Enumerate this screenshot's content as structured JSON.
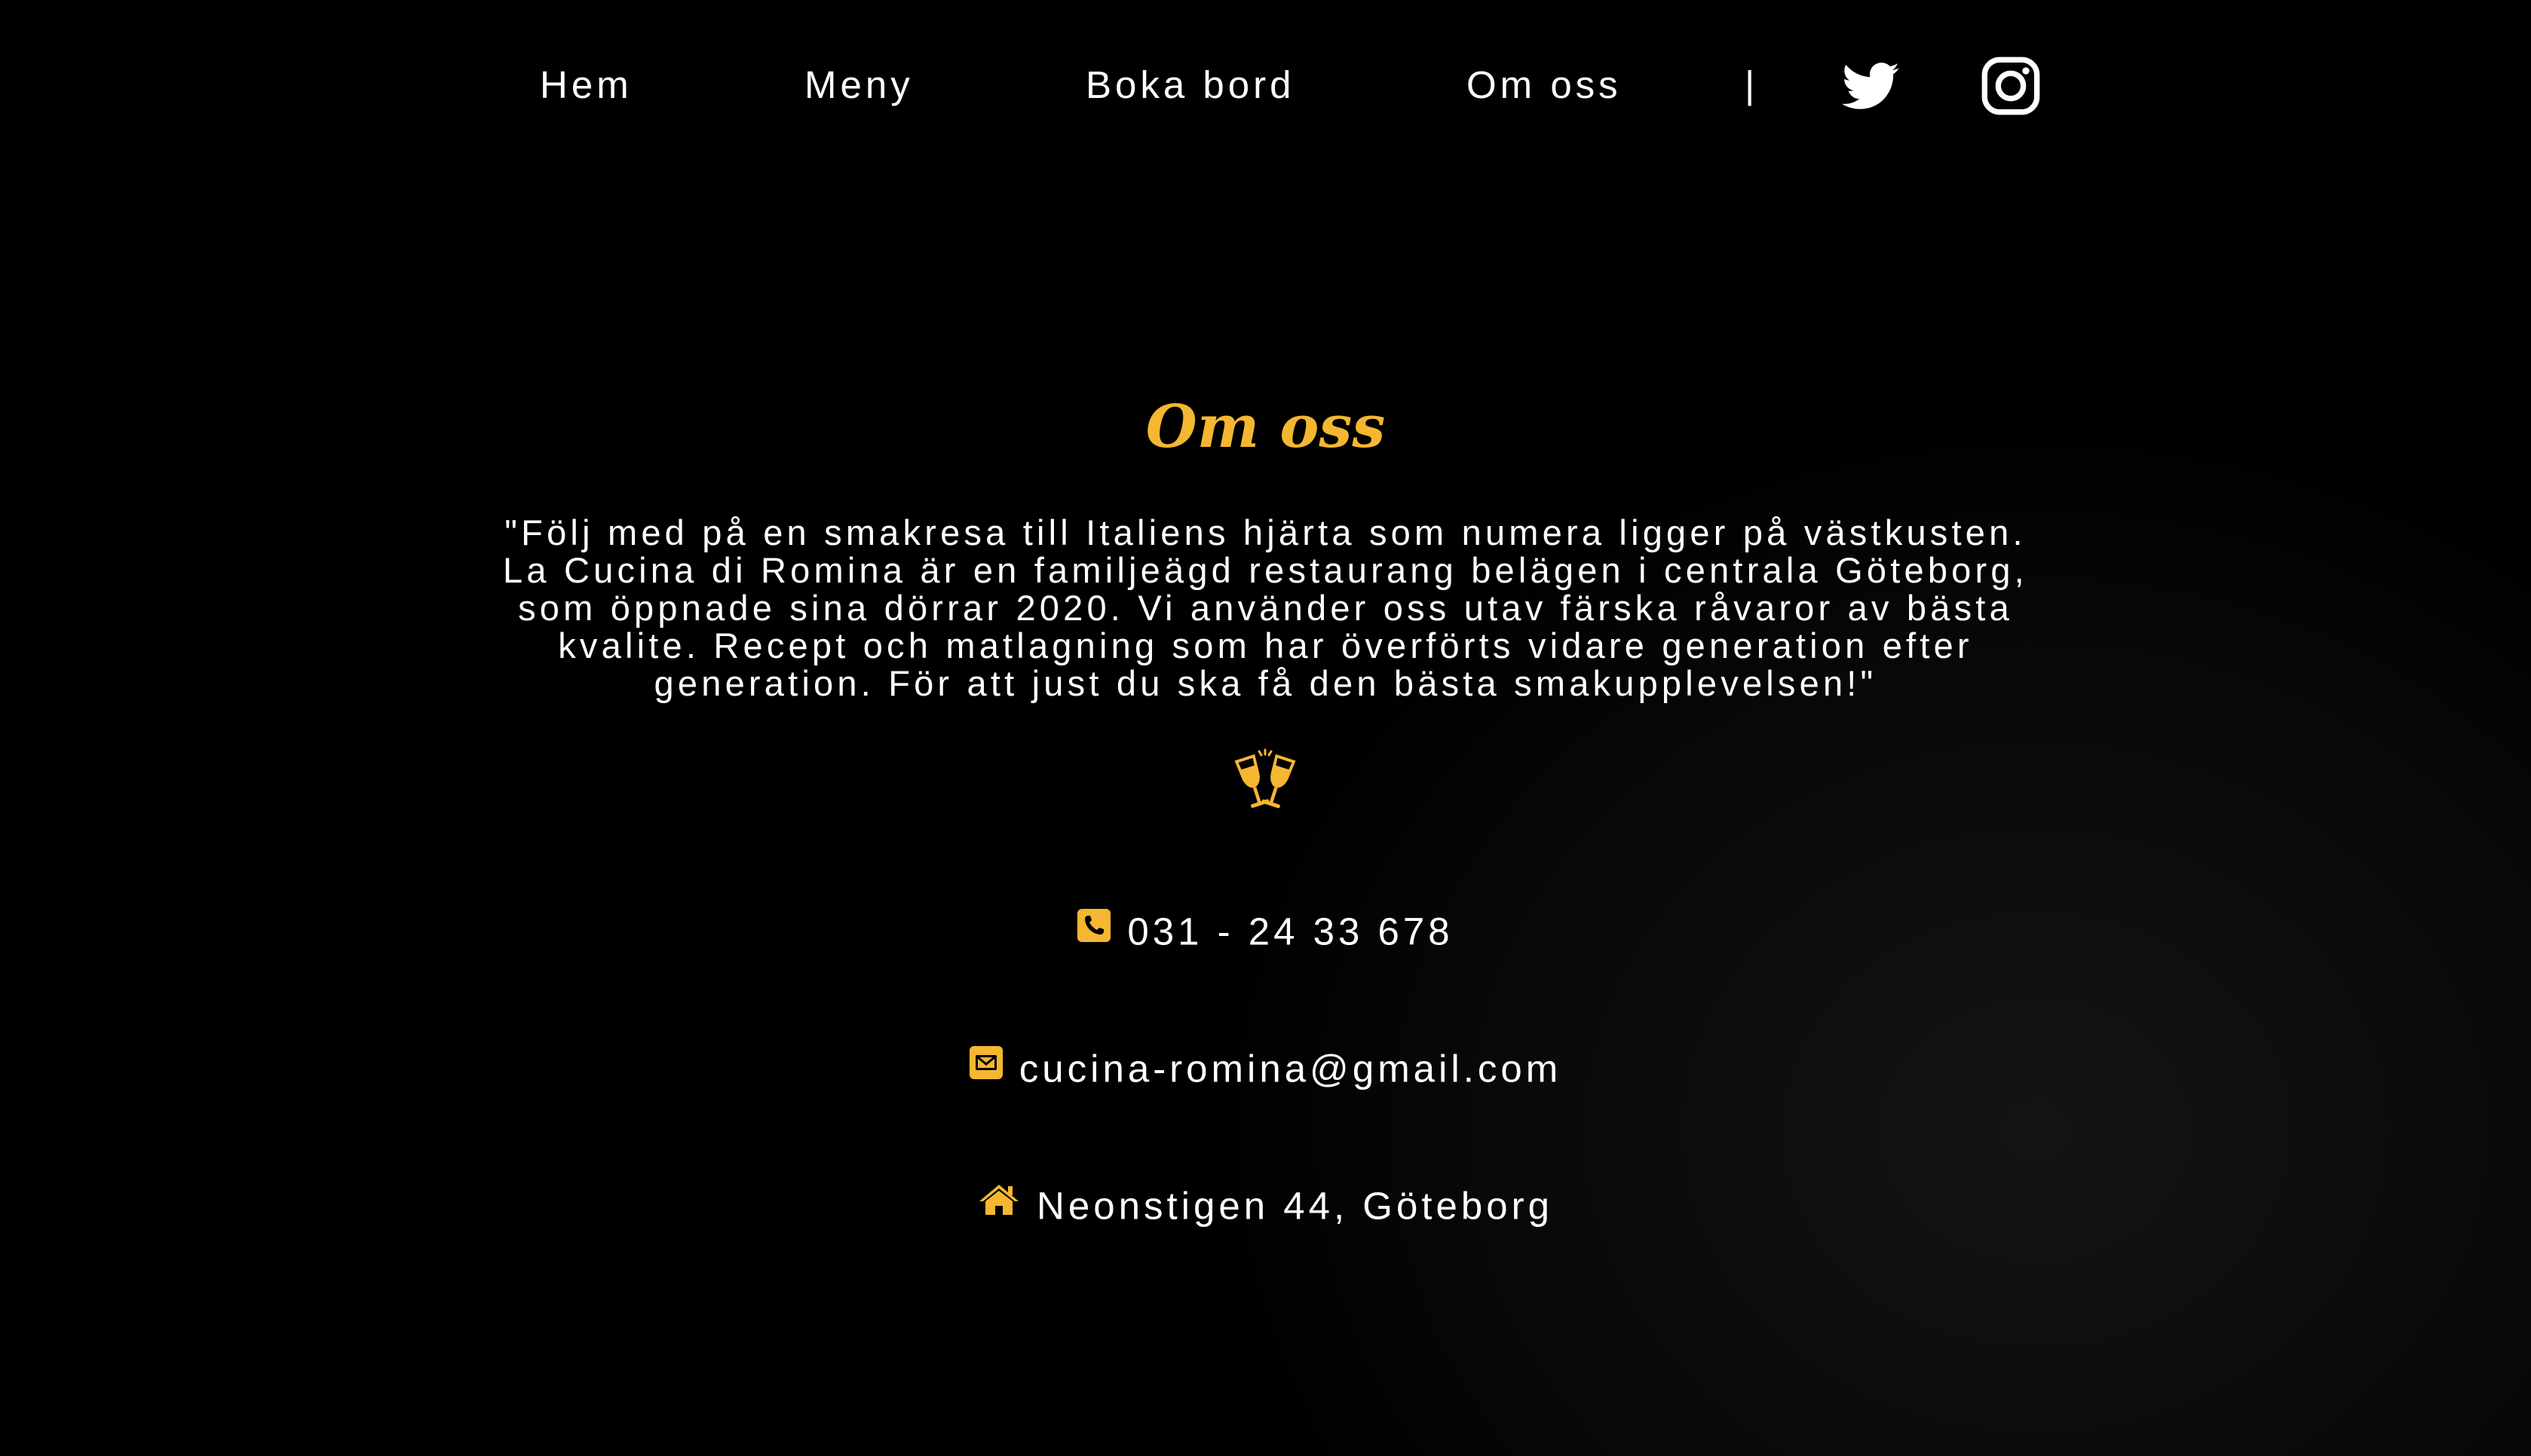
{
  "nav": {
    "items": [
      {
        "label": "Hem"
      },
      {
        "label": "Meny"
      },
      {
        "label": "Boka bord"
      },
      {
        "label": "Om oss"
      }
    ],
    "separator": "|",
    "social": [
      {
        "icon": "twitter-icon"
      },
      {
        "icon": "instagram-icon"
      }
    ]
  },
  "about": {
    "title": "Om oss",
    "intro_lines": [
      "\"Följ med på en smakresa till Italiens hjärta som numera ligger på västkusten.",
      "La Cucina di Romina är en familjeägd restaurang belägen i centrala Göteborg,",
      "som öppnade sina dörrar 2020. Vi använder oss utav färska råvaror av bästa",
      "kvalite. Recept och matlagning som har överförts vidare generation efter",
      "generation. För att just du ska få den bästa smakupplevelsen!\""
    ],
    "decor_icon": "glasses-cheers-icon"
  },
  "contact": {
    "phone": {
      "icon": "phone-icon",
      "text": "031 - 24 33 678"
    },
    "email": {
      "icon": "envelope-icon",
      "text": "cucina-romina@gmail.com"
    },
    "address": {
      "icon": "home-icon",
      "text": "Neonstigen 44, Göteborg"
    }
  },
  "colors": {
    "background": "#000000",
    "accent": "#f5b731",
    "text": "#ffffff"
  }
}
